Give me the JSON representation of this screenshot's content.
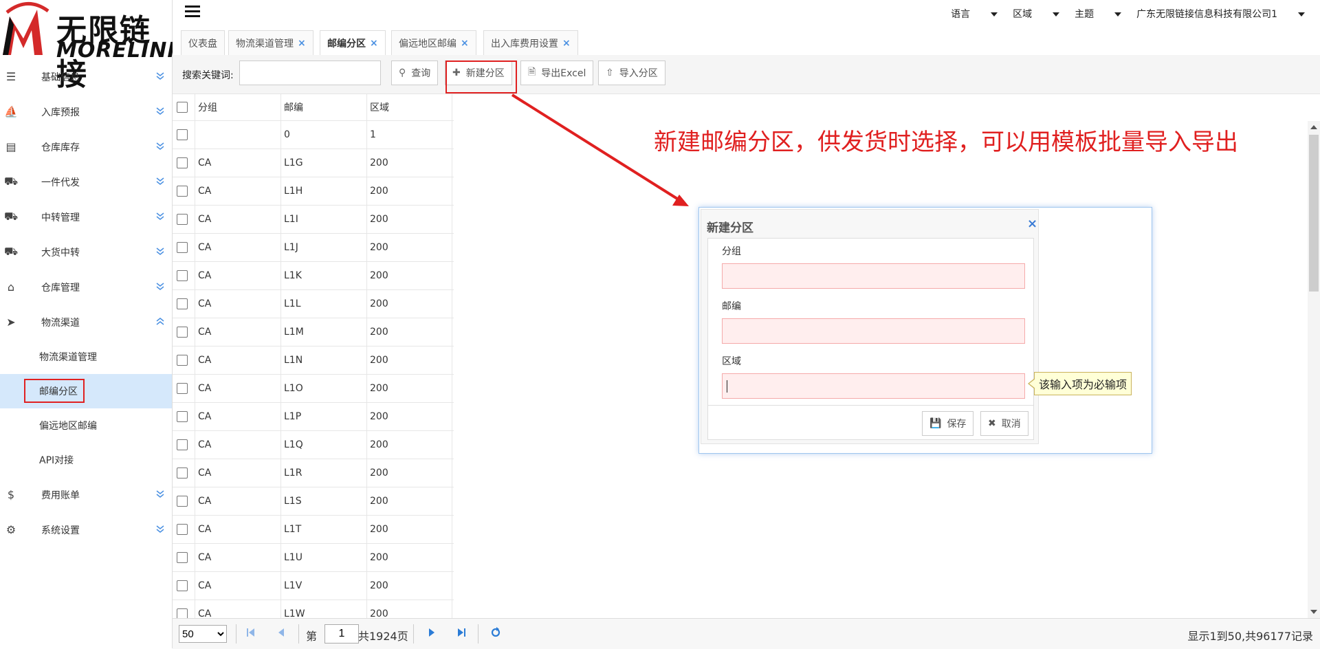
{
  "brand": {
    "cn": "无限链接",
    "en": "MORELINK"
  },
  "sidebar": {
    "items": [
      {
        "label": "基础信息",
        "icon": "list-icon",
        "expanded": false
      },
      {
        "label": "入库预报",
        "icon": "ship-icon",
        "expanded": false
      },
      {
        "label": "仓库库存",
        "icon": "inbox-icon",
        "expanded": false
      },
      {
        "label": "一件代发",
        "icon": "truck-icon",
        "expanded": false
      },
      {
        "label": "中转管理",
        "icon": "truck-icon",
        "expanded": false
      },
      {
        "label": "大货中转",
        "icon": "truck-icon",
        "expanded": false
      },
      {
        "label": "仓库管理",
        "icon": "home-icon",
        "expanded": false
      },
      {
        "label": "物流渠道",
        "icon": "cursor-icon",
        "expanded": true
      },
      {
        "label": "费用账单",
        "icon": "dollar-icon",
        "expanded": false
      },
      {
        "label": "系统设置",
        "icon": "gear-icon",
        "expanded": false
      }
    ],
    "subitems": [
      "物流渠道管理",
      "邮编分区",
      "偏远地区邮编",
      "API对接"
    ],
    "active_subitem": "邮编分区"
  },
  "topbar": {
    "language": "语言",
    "region": "区域",
    "theme": "主题",
    "company": "广东无限链接信息科技有限公司1"
  },
  "tabs": [
    {
      "label": "仪表盘",
      "closable": false
    },
    {
      "label": "物流渠道管理",
      "closable": true
    },
    {
      "label": "邮编分区",
      "closable": true,
      "active": true
    },
    {
      "label": "偏远地区邮编",
      "closable": true
    },
    {
      "label": "出入库费用设置",
      "closable": true
    }
  ],
  "toolbar": {
    "search_label": "搜索关键词:",
    "search_value": "",
    "query": "查询",
    "new_zone": "新建分区",
    "export_excel": "导出Excel",
    "import_zone": "导入分区"
  },
  "table": {
    "headers": [
      "分组",
      "邮编",
      "区域"
    ],
    "rows": [
      [
        "",
        "0",
        "1"
      ],
      [
        "CA",
        "L1G",
        "200"
      ],
      [
        "CA",
        "L1H",
        "200"
      ],
      [
        "CA",
        "L1I",
        "200"
      ],
      [
        "CA",
        "L1J",
        "200"
      ],
      [
        "CA",
        "L1K",
        "200"
      ],
      [
        "CA",
        "L1L",
        "200"
      ],
      [
        "CA",
        "L1M",
        "200"
      ],
      [
        "CA",
        "L1N",
        "200"
      ],
      [
        "CA",
        "L1O",
        "200"
      ],
      [
        "CA",
        "L1P",
        "200"
      ],
      [
        "CA",
        "L1Q",
        "200"
      ],
      [
        "CA",
        "L1R",
        "200"
      ],
      [
        "CA",
        "L1S",
        "200"
      ],
      [
        "CA",
        "L1T",
        "200"
      ],
      [
        "CA",
        "L1U",
        "200"
      ],
      [
        "CA",
        "L1V",
        "200"
      ],
      [
        "CA",
        "L1W",
        "200"
      ]
    ]
  },
  "pager": {
    "page_size": "50",
    "page_prefix": "第",
    "page_value": "1",
    "page_total": "共1924页",
    "summary": "显示1到50,共96177记录"
  },
  "annotation": "新建邮编分区，供发货时选择，可以用模板批量导入导出",
  "dialog": {
    "title": "新建分区",
    "fields": [
      "分组",
      "邮编",
      "区域"
    ],
    "save": "保存",
    "cancel": "取消",
    "tooltip": "该输入项为必输项"
  },
  "colors": {
    "accent": "#3a7bd5",
    "annotation": "#e02020",
    "active_bg": "#d5e8fb"
  }
}
